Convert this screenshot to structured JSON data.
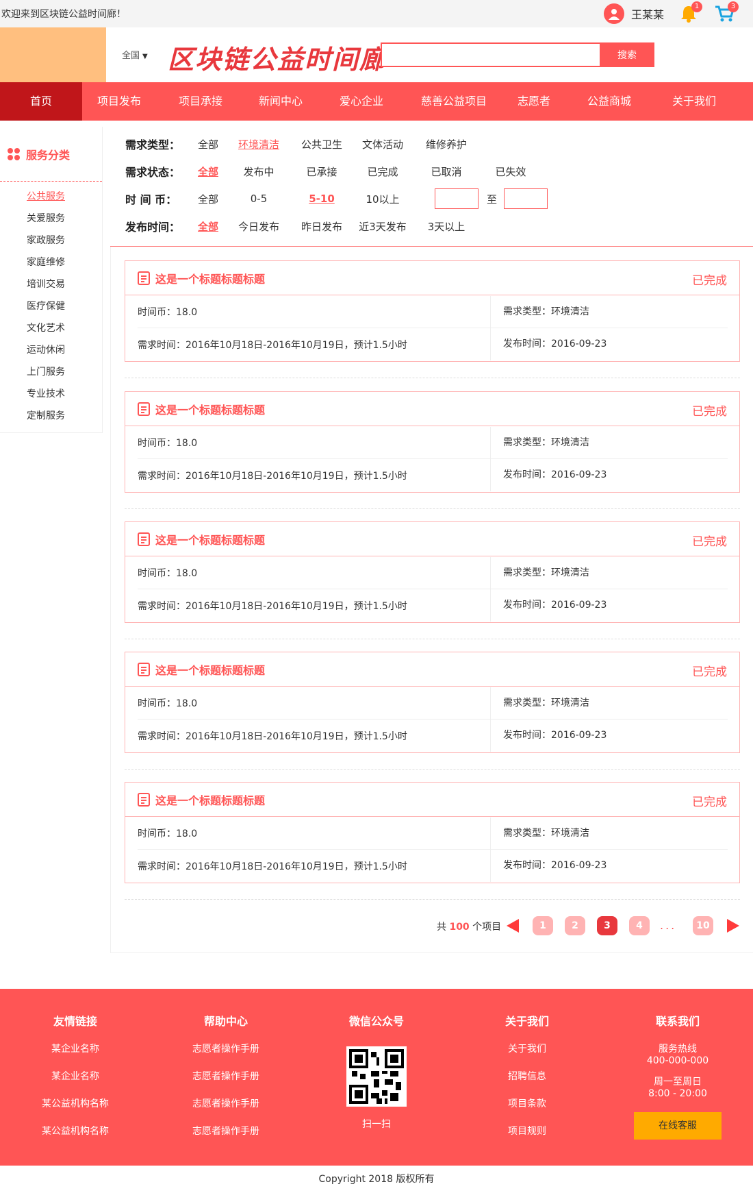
{
  "topbar": {
    "welcome": "欢迎来到区块链公益时间廊！",
    "username": "王某某",
    "notify_count": "1",
    "cart_count": "3"
  },
  "header": {
    "region": "全国",
    "site_title": "区块链公益时间廊",
    "search_placeholder": "",
    "search_label": "搜索"
  },
  "nav": {
    "items": [
      "首页",
      "项目发布",
      "项目承接",
      "新闻中心",
      "爱心企业",
      "慈善公益项目",
      "志愿者",
      "公益商城",
      "关于我们"
    ]
  },
  "sidebar": {
    "title": "服务分类",
    "items": [
      "公共服务",
      "关爱服务",
      "家政服务",
      "家庭维修",
      "培训交易",
      "医疗保健",
      "文化艺术",
      "运动休闲",
      "上门服务",
      "专业技术",
      "定制服务"
    ]
  },
  "filters": {
    "type": {
      "label": "需求类型：",
      "options": [
        "全部",
        "环境清洁",
        "公共卫生",
        "文体活动",
        "维修养护"
      ]
    },
    "status": {
      "label": "需求状态：",
      "options": [
        "全部",
        "发布中",
        "已承接",
        "已完成",
        "已取消",
        "已失效"
      ]
    },
    "coin": {
      "label": "时 间 币：",
      "options": [
        "全部",
        "0-5",
        "5-10",
        "10以上"
      ],
      "to": "至"
    },
    "time": {
      "label": "发布时间：",
      "options": [
        "全部",
        "今日发布",
        "昨日发布",
        "近3天发布",
        "3天以上"
      ]
    }
  },
  "cards": [
    {
      "title": "这是一个标题标题标题",
      "status": "已完成",
      "coin": "时间币：18.0",
      "type": "需求类型：环境清洁",
      "period": "需求时间：2016年10月18日-2016年10月19日，预计1.5小时",
      "published": "发布时间：2016-09-23"
    },
    {
      "title": "这是一个标题标题标题",
      "status": "已完成",
      "coin": "时间币：18.0",
      "type": "需求类型：环境清洁",
      "period": "需求时间：2016年10月18日-2016年10月19日，预计1.5小时",
      "published": "发布时间：2016-09-23"
    },
    {
      "title": "这是一个标题标题标题",
      "status": "已完成",
      "coin": "时间币：18.0",
      "type": "需求类型：环境清洁",
      "period": "需求时间：2016年10月18日-2016年10月19日，预计1.5小时",
      "published": "发布时间：2016-09-23"
    },
    {
      "title": "这是一个标题标题标题",
      "status": "已完成",
      "coin": "时间币：18.0",
      "type": "需求类型：环境清洁",
      "period": "需求时间：2016年10月18日-2016年10月19日，预计1.5小时",
      "published": "发布时间：2016-09-23"
    },
    {
      "title": "这是一个标题标题标题",
      "status": "已完成",
      "coin": "时间币：18.0",
      "type": "需求类型：环境清洁",
      "period": "需求时间：2016年10月18日-2016年10月19日，预计1.5小时",
      "published": "发布时间：2016-09-23"
    }
  ],
  "pagination": {
    "prefix": "共",
    "total": "100",
    "suffix": "个项目",
    "pages": [
      "1",
      "2",
      "3",
      "4",
      "10"
    ],
    "current": "3",
    "ellipsis": "..."
  },
  "footer": {
    "links": {
      "title": "友情链接",
      "items": [
        "某企业名称",
        "某企业名称",
        "某公益机构名称",
        "某公益机构名称"
      ]
    },
    "help": {
      "title": "帮助中心",
      "items": [
        "志愿者操作手册",
        "志愿者操作手册",
        "志愿者操作手册",
        "志愿者操作手册"
      ]
    },
    "wechat": {
      "title": "微信公众号",
      "caption": "扫一扫"
    },
    "about": {
      "title": "关于我们",
      "items": [
        "关于我们",
        "招聘信息",
        "项目条款",
        "项目规则"
      ]
    },
    "contact": {
      "title": "联系我们",
      "hotline_label": "服务热线",
      "hotline": "400-000-000",
      "hours_label": "周一至周日",
      "hours": "8:00 - 20:00",
      "service_label": "在线客服"
    },
    "copyright": "Copyright 2018 版权所有"
  },
  "colors": {
    "primary": "#ff5555",
    "nav_active": "#c0161a",
    "logo_block": "#ffbf7f",
    "service_button": "#ffaa00"
  }
}
